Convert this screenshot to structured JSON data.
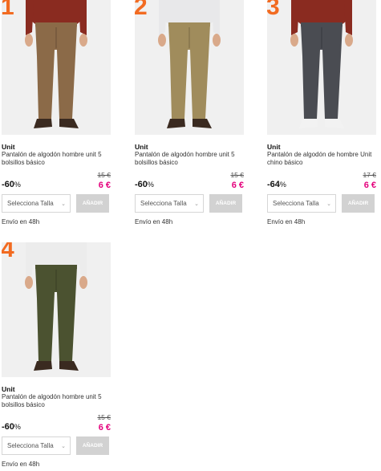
{
  "products": [
    {
      "rank": "1",
      "brand": "Unit",
      "title": "Pantalón de algodón hombre unit 5 bolsillos básico",
      "discount": "-60",
      "old_price": "15 €",
      "new_price": "6 €",
      "pants_color": "#8b6a48",
      "shoe_color": "#3a2a20",
      "shirt_color": "#8a2b20",
      "skin_color": "#d9a98a"
    },
    {
      "rank": "2",
      "brand": "Unit",
      "title": "Pantalón de algodón hombre unit 5 bolsillos básico",
      "discount": "-60",
      "old_price": "15 €",
      "new_price": "6 €",
      "pants_color": "#a08c5c",
      "shoe_color": "#3a2a20",
      "shirt_color": "#e8e8ea",
      "skin_color": "#d9a98a"
    },
    {
      "rank": "3",
      "brand": "Unit",
      "title": "Pantalón de algodón de hombre Unit chino básico",
      "discount": "-64",
      "old_price": "17 €",
      "new_price": "6 €",
      "pants_color": "#4a4c52",
      "shoe_color": "#f2f2f2",
      "shirt_color": "#8a2b20",
      "skin_color": "#d9a98a"
    },
    {
      "rank": "4",
      "brand": "Unit",
      "title": "Pantalón de algodón hombre unit 5 bolsillos básico",
      "discount": "-60",
      "old_price": "15 €",
      "new_price": "6 €",
      "pants_color": "#4b5230",
      "shoe_color": "#3a2a20",
      "shirt_color": "#ececec",
      "skin_color": "#d9a98a"
    }
  ],
  "labels": {
    "percent": "%",
    "size_select": "Selecciona Talla",
    "add_button": "AÑADIR",
    "delivery": "Envío en 48h"
  },
  "colors": {
    "rank_accent": "#f26b21",
    "sale_price": "#e4007c",
    "add_button_bg": "#d2d2d2"
  }
}
